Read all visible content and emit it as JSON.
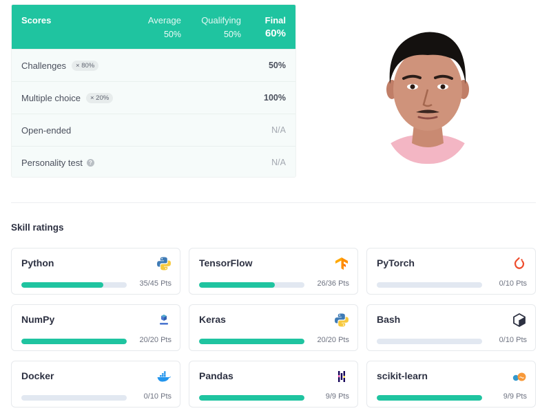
{
  "scores": {
    "title": "Scores",
    "average": {
      "label": "Average",
      "value": "50%"
    },
    "qualifying": {
      "label": "Qualifying",
      "value": "50%"
    },
    "final": {
      "label": "Final",
      "value": "60%"
    },
    "rows": [
      {
        "name": "Challenges",
        "weight": "× 80%",
        "value": "50%"
      },
      {
        "name": "Multiple choice",
        "weight": "× 20%",
        "value": "100%"
      },
      {
        "name": "Open-ended",
        "value": "N/A"
      },
      {
        "name": "Personality test",
        "value": "N/A"
      }
    ]
  },
  "skills": {
    "title": "Skill ratings",
    "items": [
      {
        "name": "Python",
        "pts": "35/45 Pts",
        "fill": 0.7778,
        "icon": "python-icon"
      },
      {
        "name": "TensorFlow",
        "pts": "26/36 Pts",
        "fill": 0.7222,
        "icon": "tensorflow-icon"
      },
      {
        "name": "PyTorch",
        "pts": "0/10 Pts",
        "fill": 0,
        "icon": "pytorch-icon"
      },
      {
        "name": "NumPy",
        "pts": "20/20 Pts",
        "fill": 1,
        "icon": "numpy-icon"
      },
      {
        "name": "Keras",
        "pts": "20/20 Pts",
        "fill": 1,
        "icon": "python-icon"
      },
      {
        "name": "Bash",
        "pts": "0/10 Pts",
        "fill": 0,
        "icon": "bash-icon"
      },
      {
        "name": "Docker",
        "pts": "0/10 Pts",
        "fill": 0,
        "icon": "docker-icon"
      },
      {
        "name": "Pandas",
        "pts": "9/9 Pts",
        "fill": 1,
        "icon": "pandas-icon"
      },
      {
        "name": "scikit-learn",
        "pts": "9/9 Pts",
        "fill": 1,
        "icon": "scikit-learn-icon"
      }
    ]
  },
  "colors": {
    "accent": "#1fc4a0",
    "track": "#e2e8f1"
  }
}
